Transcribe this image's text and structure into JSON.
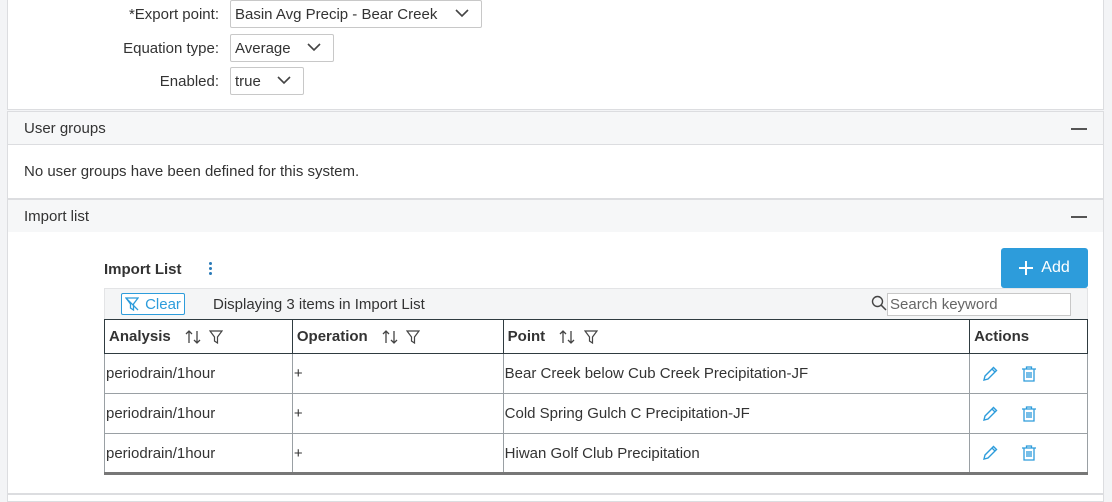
{
  "form": {
    "export_point": {
      "label": "*Export point:",
      "value": "Basin Avg Precip - Bear Creek"
    },
    "equation_type": {
      "label": "Equation type:",
      "value": "Average"
    },
    "enabled": {
      "label": "Enabled:",
      "value": "true"
    }
  },
  "user_groups": {
    "title": "User groups",
    "empty_text": "No user groups have been defined for this system."
  },
  "import_list_section": {
    "title": "Import list"
  },
  "import_list": {
    "title": "Import List",
    "add_label": "Add",
    "clear_label": "Clear",
    "display_text": "Displaying 3 items in Import List",
    "search_placeholder": "Search keyword",
    "columns": [
      "Analysis",
      "Operation",
      "Point",
      "Actions"
    ],
    "rows": [
      {
        "analysis": "periodrain/1hour",
        "operation": "+",
        "point": "Bear Creek below Cub Creek Precipitation-JF"
      },
      {
        "analysis": "periodrain/1hour",
        "operation": "+",
        "point": "Cold Spring Gulch C Precipitation-JF"
      },
      {
        "analysis": "periodrain/1hour",
        "operation": "+",
        "point": "Hiwan Golf Club Precipitation"
      }
    ]
  },
  "icons": {
    "accent": "#2d9cdb",
    "edit": "pencil-icon",
    "delete": "trash-icon",
    "sort": "sort-icon",
    "filter": "filter-icon",
    "search": "search-icon",
    "kebab": "kebab-menu-icon",
    "collapse": "minus-icon",
    "chevron": "chevron-down-icon"
  }
}
